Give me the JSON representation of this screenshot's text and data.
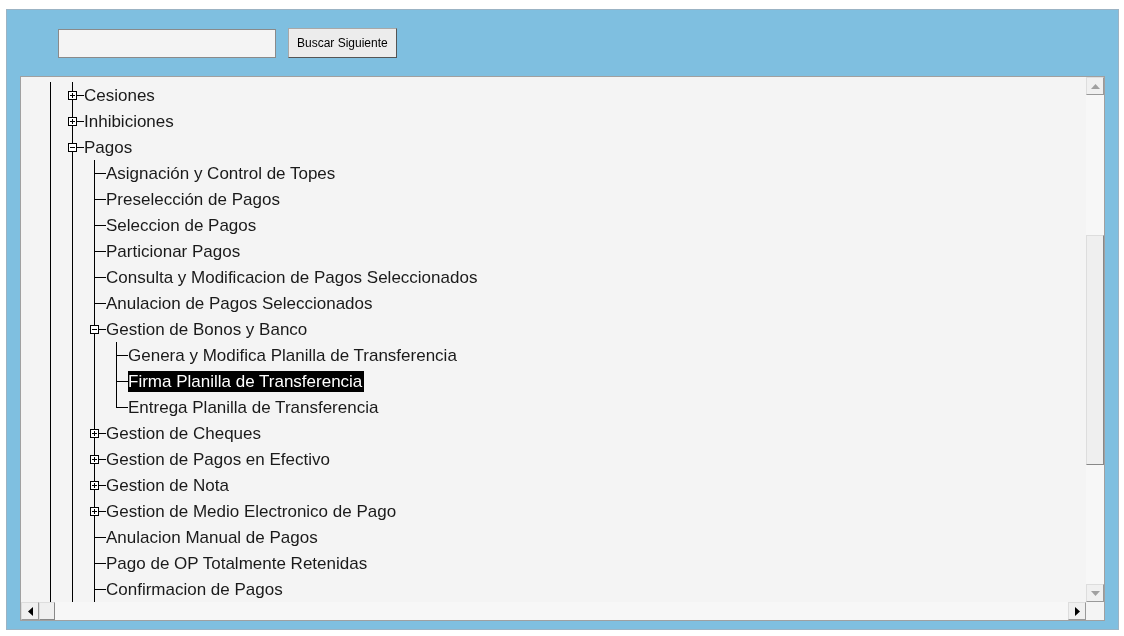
{
  "search_button": "Buscar Siguiente",
  "tree": {
    "items": [
      {
        "label": "Cesiones",
        "expanded": false,
        "selected": false
      },
      {
        "label": "Inhibiciones",
        "expanded": false,
        "selected": false
      },
      {
        "label": "Pagos",
        "expanded": true,
        "selected": false,
        "children": [
          {
            "label": "Asignación y Control de Topes",
            "selected": false
          },
          {
            "label": "Preselección de Pagos",
            "selected": false
          },
          {
            "label": "Seleccion de Pagos",
            "selected": false
          },
          {
            "label": "Particionar Pagos",
            "selected": false
          },
          {
            "label": "Consulta y Modificacion de Pagos Seleccionados",
            "selected": false
          },
          {
            "label": "Anulacion de Pagos Seleccionados",
            "selected": false
          },
          {
            "label": "Gestion de Bonos y Banco",
            "expanded": true,
            "selected": false,
            "children": [
              {
                "label": "Genera y Modifica Planilla de Transferencia",
                "selected": false
              },
              {
                "label": "Firma Planilla de Transferencia",
                "selected": true
              },
              {
                "label": "Entrega Planilla de Transferencia",
                "selected": false
              }
            ]
          },
          {
            "label": "Gestion de Cheques",
            "expanded": false,
            "selected": false
          },
          {
            "label": "Gestion de Pagos en Efectivo",
            "expanded": false,
            "selected": false
          },
          {
            "label": "Gestion de Nota",
            "expanded": false,
            "selected": false
          },
          {
            "label": "Gestion de Medio Electronico de Pago",
            "expanded": false,
            "selected": false
          },
          {
            "label": "Anulacion Manual de Pagos",
            "selected": false
          },
          {
            "label": "Pago de OP Totalmente Retenidas",
            "selected": false
          },
          {
            "label": "Confirmacion de Pagos",
            "selected": false
          }
        ]
      }
    ]
  }
}
